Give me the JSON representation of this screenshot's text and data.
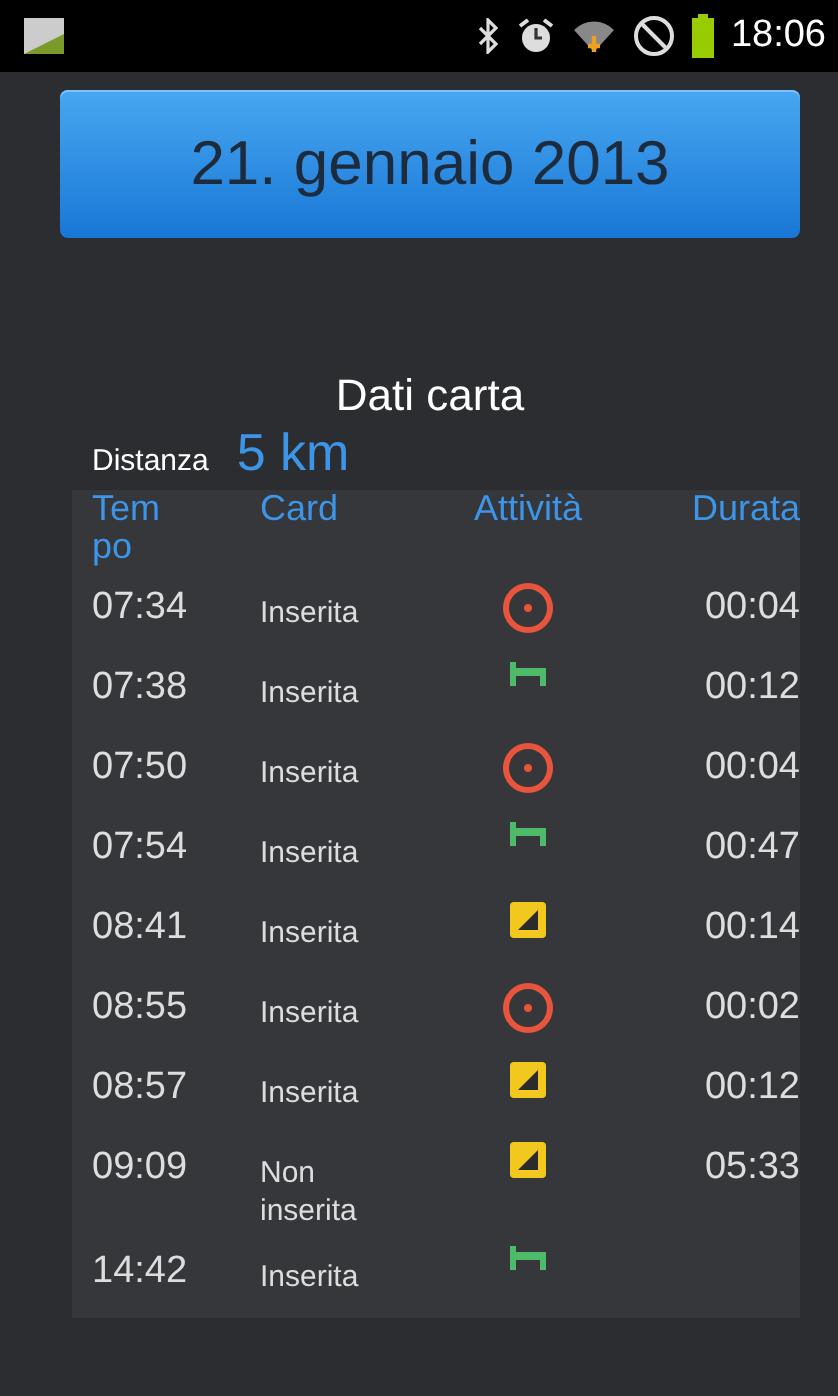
{
  "status_bar": {
    "time": "18:06"
  },
  "date_button": {
    "label": "21. gennaio 2013"
  },
  "title": "Dati carta",
  "distance": {
    "label": "Distanza",
    "value": "5 km"
  },
  "table": {
    "columns": [
      "Tempo",
      "Card",
      "Attività",
      "Durata"
    ],
    "rows": [
      {
        "time": "07:34",
        "card": "Inserita",
        "kind": "driving",
        "duration": "00:04"
      },
      {
        "time": "07:38",
        "card": "Inserita",
        "kind": "rest",
        "duration": "00:12"
      },
      {
        "time": "07:50",
        "card": "Inserita",
        "kind": "driving",
        "duration": "00:04"
      },
      {
        "time": "07:54",
        "card": "Inserita",
        "kind": "rest",
        "duration": "00:47"
      },
      {
        "time": "08:41",
        "card": "Inserita",
        "kind": "availability",
        "duration": "00:14"
      },
      {
        "time": "08:55",
        "card": "Inserita",
        "kind": "driving",
        "duration": "00:02"
      },
      {
        "time": "08:57",
        "card": "Inserita",
        "kind": "availability",
        "duration": "00:12"
      },
      {
        "time": "09:09",
        "card": "Non inserita",
        "kind": "availability",
        "duration": "05:33"
      },
      {
        "time": "14:42",
        "card": "Inserita",
        "kind": "rest"
      }
    ]
  }
}
